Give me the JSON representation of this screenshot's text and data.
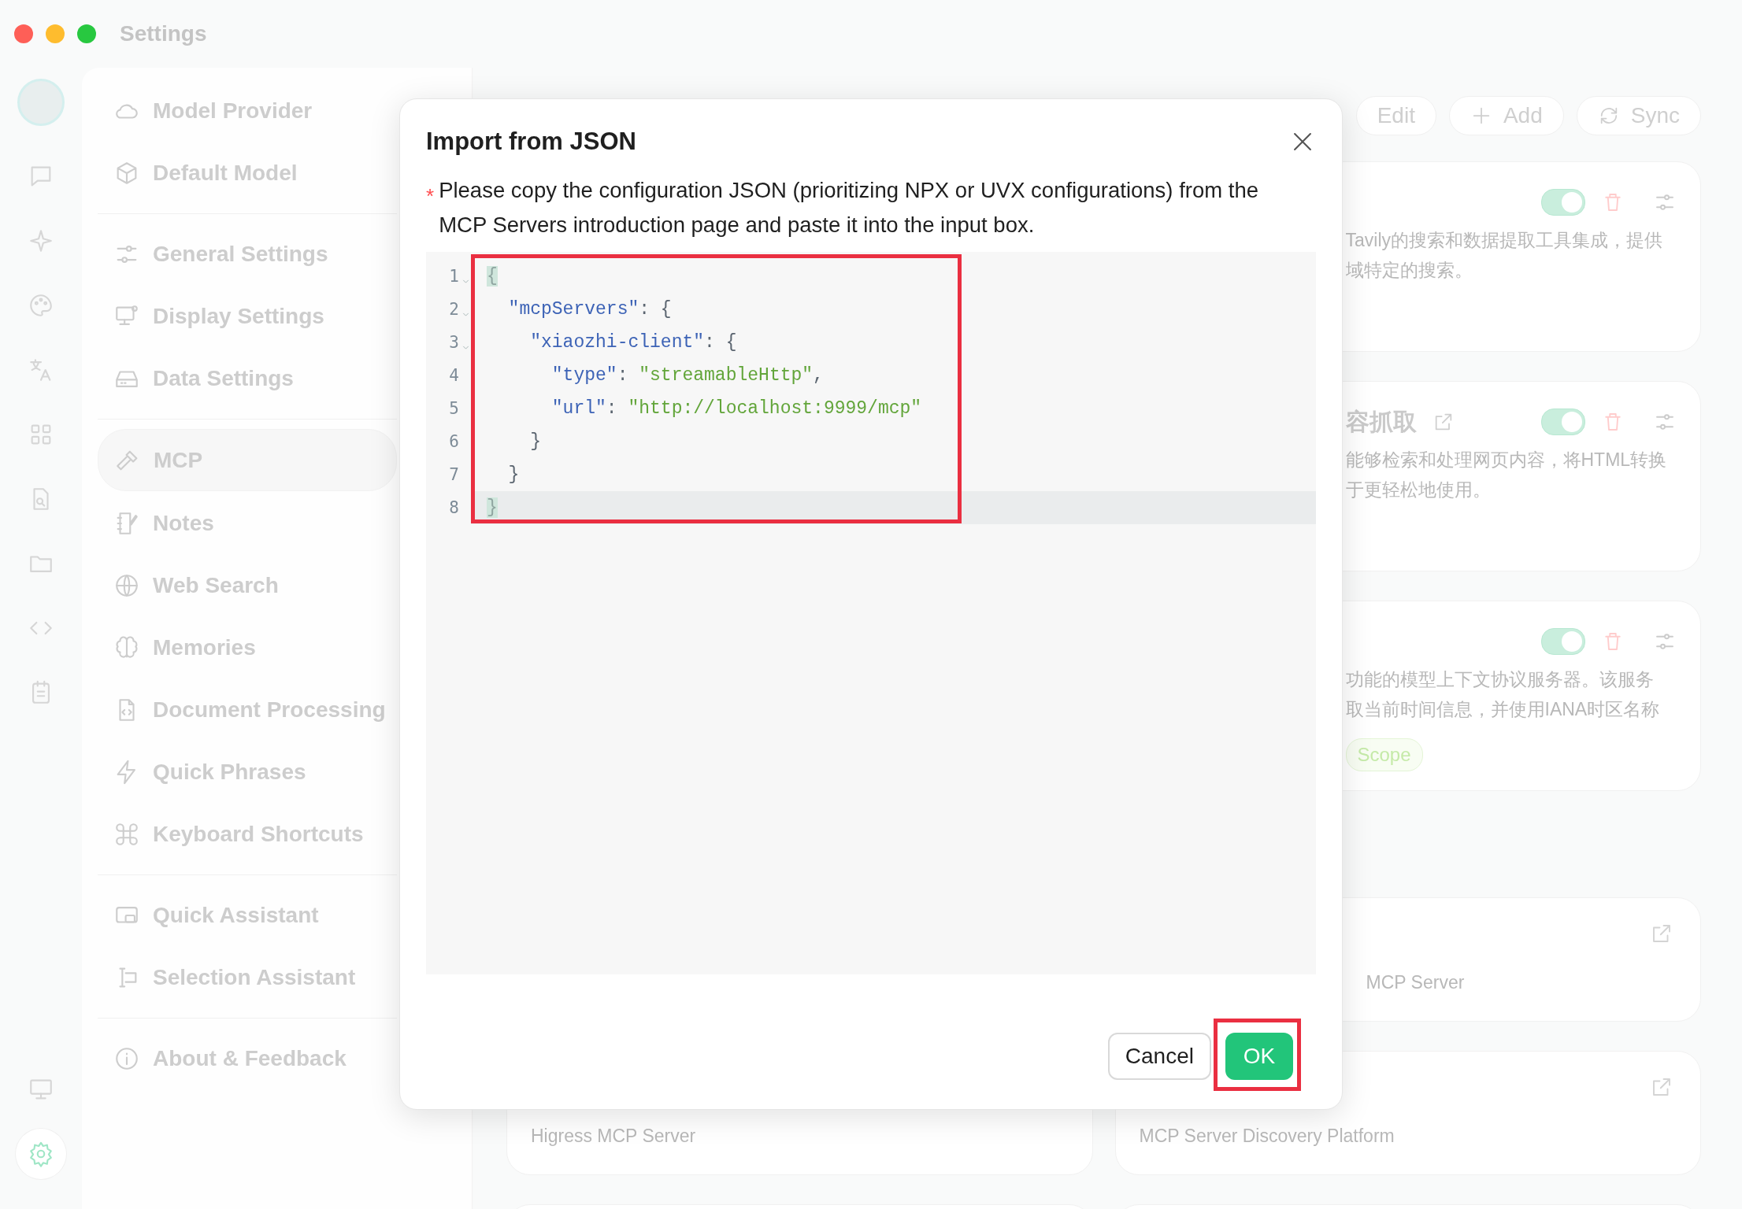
{
  "window": {
    "title": "Settings"
  },
  "rail": {
    "top": [
      {
        "selected": false
      },
      {
        "selected": false
      },
      {
        "selected": false
      },
      {
        "selected": false
      },
      {
        "selected": false
      },
      {
        "selected": false
      },
      {
        "selected": false
      },
      {
        "selected": false
      },
      {
        "selected": false
      }
    ],
    "bottom": [
      {
        "selected": false
      },
      {
        "selected": true
      }
    ]
  },
  "nav": {
    "groups": [
      {
        "items": [
          {
            "label": "Model Provider",
            "selected": false
          },
          {
            "label": "Default Model",
            "selected": false
          }
        ]
      },
      {
        "items": [
          {
            "label": "General Settings",
            "selected": false
          },
          {
            "label": "Display Settings",
            "selected": false
          },
          {
            "label": "Data Settings",
            "selected": false
          }
        ]
      },
      {
        "items": [
          {
            "label": "MCP",
            "selected": true
          },
          {
            "label": "Notes",
            "selected": false
          },
          {
            "label": "Web Search",
            "selected": false
          },
          {
            "label": "Memories",
            "selected": false
          },
          {
            "label": "Document Processing",
            "selected": false
          },
          {
            "label": "Quick Phrases",
            "selected": false
          },
          {
            "label": "Keyboard Shortcuts",
            "selected": false
          }
        ]
      },
      {
        "items": [
          {
            "label": "Quick Assistant",
            "selected": false
          },
          {
            "label": "Selection Assistant",
            "selected": false
          }
        ]
      },
      {
        "items": [
          {
            "label": "About & Feedback",
            "selected": false
          }
        ]
      }
    ]
  },
  "toolbar": {
    "buttons": [
      {
        "label": "Edit"
      },
      {
        "label": "Add"
      },
      {
        "label": "Sync"
      }
    ]
  },
  "cards_right": [
    {
      "kind": "toggle",
      "on": true,
      "description": [
        "Tavily的搜索和数据提取工具集成，提供",
        "域特定的搜索。"
      ]
    },
    {
      "kind": "toggle",
      "title": "容抓取",
      "on": true,
      "description": [
        "能够检索和处理网页内容，将HTML转换",
        "于更轻松地使用。"
      ]
    },
    {
      "kind": "toggle",
      "on": true,
      "description": [
        "功能的模型上下文协议服务器。该服务",
        "取当前时间信息，并使用IANA时区名称"
      ],
      "tags": [
        "Scope"
      ]
    },
    {
      "kind": "link-partial",
      "description": [
        "MCP Server"
      ]
    },
    {
      "kind": "link",
      "description": [
        "MCP Server Discovery Platform"
      ]
    }
  ],
  "cards_left": [
    {
      "kind": "link",
      "description": [
        "Higress MCP Server"
      ]
    }
  ],
  "dialog": {
    "title": "Import from JSON",
    "required": true,
    "required_mark": "*",
    "description": "Please copy the configuration JSON (prioritizing NPX or UVX configurations) from the MCP Servers introduction page and paste it into the input box.",
    "editor": {
      "highlighted": true,
      "lines": [
        {
          "number": "1",
          "foldable": true,
          "active": false,
          "tokens": [
            {
              "kind": "bracket",
              "text": "{"
            }
          ]
        },
        {
          "number": "2",
          "foldable": true,
          "active": false,
          "tokens": [
            {
              "kind": "key",
              "text": "  \"mcpServers\""
            },
            {
              "kind": "plain",
              "text": ": {"
            }
          ]
        },
        {
          "number": "3",
          "foldable": true,
          "active": false,
          "tokens": [
            {
              "kind": "key",
              "text": "    \"xiaozhi-client\""
            },
            {
              "kind": "plain",
              "text": ": {"
            }
          ]
        },
        {
          "number": "4",
          "foldable": false,
          "active": false,
          "tokens": [
            {
              "kind": "key",
              "text": "      \"type\""
            },
            {
              "kind": "plain",
              "text": ": "
            },
            {
              "kind": "string",
              "text": "\"streamableHttp\""
            },
            {
              "kind": "plain",
              "text": ","
            }
          ]
        },
        {
          "number": "5",
          "foldable": false,
          "active": false,
          "tokens": [
            {
              "kind": "key",
              "text": "      \"url\""
            },
            {
              "kind": "plain",
              "text": ": "
            },
            {
              "kind": "string",
              "text": "\"http://localhost:9999/mcp\""
            }
          ]
        },
        {
          "number": "6",
          "foldable": false,
          "active": false,
          "tokens": [
            {
              "kind": "plain",
              "text": "    }"
            }
          ]
        },
        {
          "number": "7",
          "foldable": false,
          "active": false,
          "tokens": [
            {
              "kind": "plain",
              "text": "  }"
            }
          ]
        },
        {
          "number": "8",
          "foldable": false,
          "active": true,
          "tokens": [
            {
              "kind": "bracket",
              "text": "}"
            }
          ]
        }
      ]
    },
    "buttons": [
      {
        "label": "Cancel",
        "kind": "secondary",
        "highlighted": false
      },
      {
        "label": "OK",
        "kind": "primary",
        "highlighted": true
      }
    ]
  }
}
